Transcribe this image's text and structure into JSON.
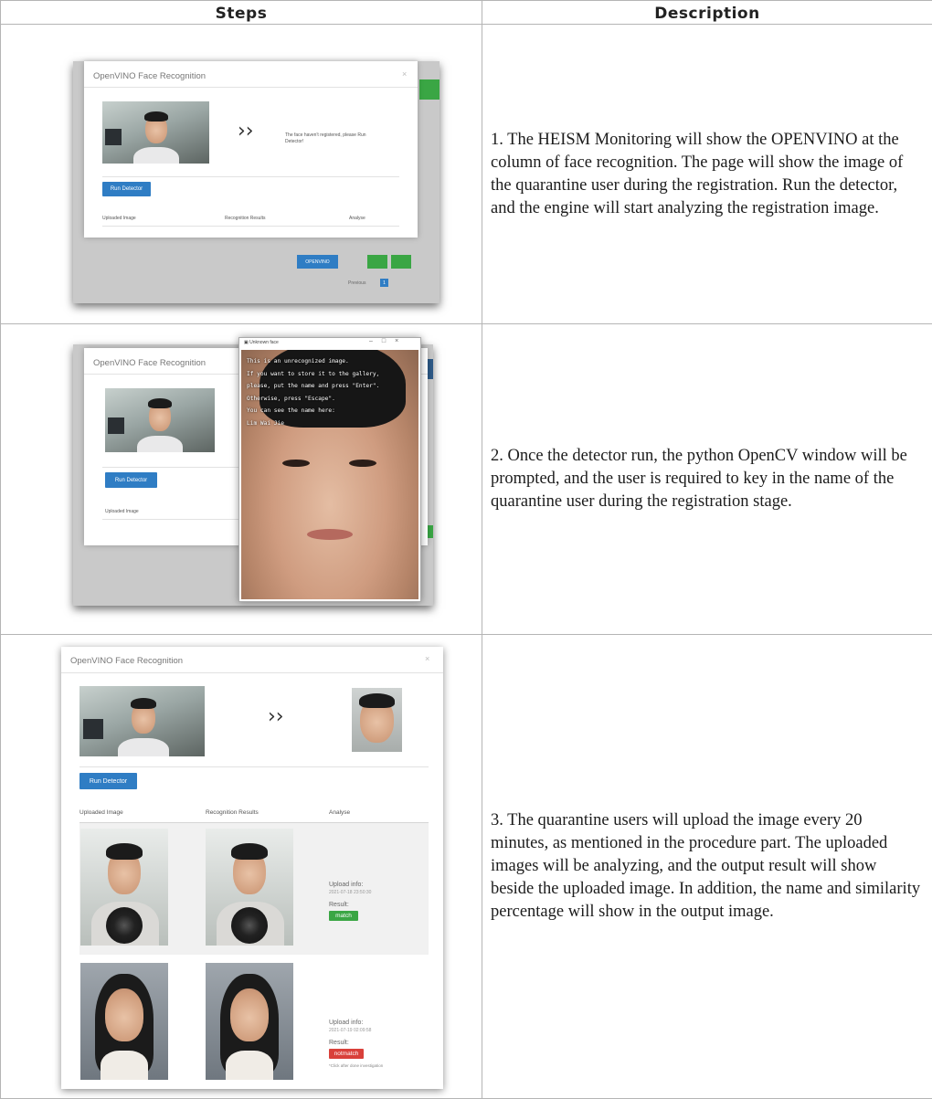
{
  "headers": {
    "steps": "Steps",
    "description": "Description"
  },
  "rows": [
    {
      "description": "1. The HEISM Monitoring will show the OPENVINO at the column of face recognition. The page will show the image of the quarantine user during the registration.  Run the detector, and the engine will start analyzing the registration image.",
      "shot": {
        "title": "OpenVINO Face Recognition",
        "message": "The face haven't registered, please Run Detector!",
        "run_button": "Run Detector",
        "col_uploaded": "Uploaded Image",
        "col_results": "Recognition Results",
        "col_analyse": "Analyse",
        "bg_openvino": "OPENVINO",
        "bg_previous": "Previous",
        "bg_page": "1"
      }
    },
    {
      "description": "2. Once the detector run, the python OpenCV window will be prompted, and the user is required to key in the name of the quarantine user during the registration stage.",
      "shot": {
        "title": "OpenVINO Face Recognition",
        "run_button": "Run Detector",
        "col_uploaded": "Uploaded Image",
        "window_title": "Unknown face",
        "overlay_lines": [
          "This is an unrecognized image.",
          "If you want to store it to the gallery,",
          "please, put the name and press \"Enter\".",
          "Otherwise, press \"Escape\".",
          "You can see the name here:",
          "Lim Wai Jie"
        ]
      }
    },
    {
      "description": "3. The quarantine users will upload the image every 20 minutes, as mentioned in the procedure part. The uploaded images will be analyzing, and the output result will show beside the uploaded image. In addition, the name and similarity percentage will show in the output image.",
      "shot": {
        "title": "OpenVINO Face Recognition",
        "run_button": "Run Detector",
        "col_uploaded": "Uploaded Image",
        "col_results": "Recognition Results",
        "col_analyse": "Analyse",
        "entries": [
          {
            "upload_info": "Upload info:",
            "time": "2021-07-18 23:50:30",
            "result_label": "Result:",
            "result": "match",
            "result_color": "#3aa644"
          },
          {
            "upload_info": "Upload info:",
            "time": "2021-07-19 02:09:58",
            "result_label": "Result:",
            "result": "notmatch",
            "result_color": "#d9403a",
            "note": "*Click after done investigation"
          }
        ]
      }
    }
  ],
  "colors": {
    "button_blue": "#2f7dc4",
    "match_green": "#3aa644",
    "notmatch_red": "#d9403a",
    "bg_green": "#3aa644"
  }
}
